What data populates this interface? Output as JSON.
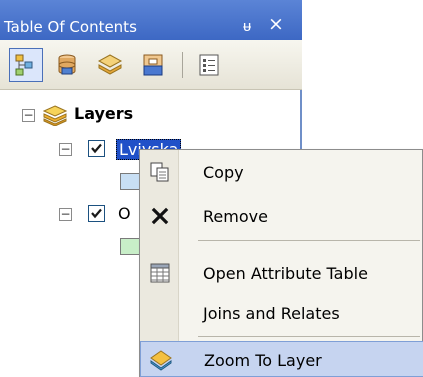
{
  "toc": {
    "title": "Table Of Contents",
    "pin_glyph": "ᵾ",
    "close_glyph": "×",
    "toolbar": [
      {
        "name": "list-by-drawing-order",
        "icon": "list-by-drawing-order-icon",
        "active": true
      },
      {
        "name": "list-by-source",
        "icon": "list-by-source-icon",
        "active": false
      },
      {
        "name": "list-by-visibility",
        "icon": "list-by-visibility-icon",
        "active": false
      },
      {
        "name": "list-by-selection",
        "icon": "list-by-selection-icon",
        "active": false
      },
      {
        "name": "options",
        "icon": "options-icon",
        "active": false
      }
    ],
    "tree": {
      "root_label": "Layers",
      "expand_glyph": "−",
      "layers": [
        {
          "label": "Lviyska",
          "checked": true,
          "selected": true,
          "swatch_color": "#c8dff4"
        },
        {
          "label": "O",
          "checked": true,
          "selected": false,
          "swatch_color": "#c8eec8"
        }
      ]
    }
  },
  "context_menu": {
    "items": [
      {
        "label": "Copy",
        "icon": "copy-icon"
      },
      {
        "label": "Remove",
        "icon": "remove-icon"
      },
      {
        "label": "Open Attribute Table",
        "icon": "attribute-table-icon"
      },
      {
        "label": "Joins and Relates",
        "icon": ""
      },
      {
        "label": "Zoom To Layer",
        "icon": "zoom-to-layer-icon",
        "highlighted": true
      }
    ]
  },
  "colors": {
    "title_bar": "#3d68c4",
    "selection": "#2050c8",
    "menu_highlight": "#c6d4f0"
  }
}
